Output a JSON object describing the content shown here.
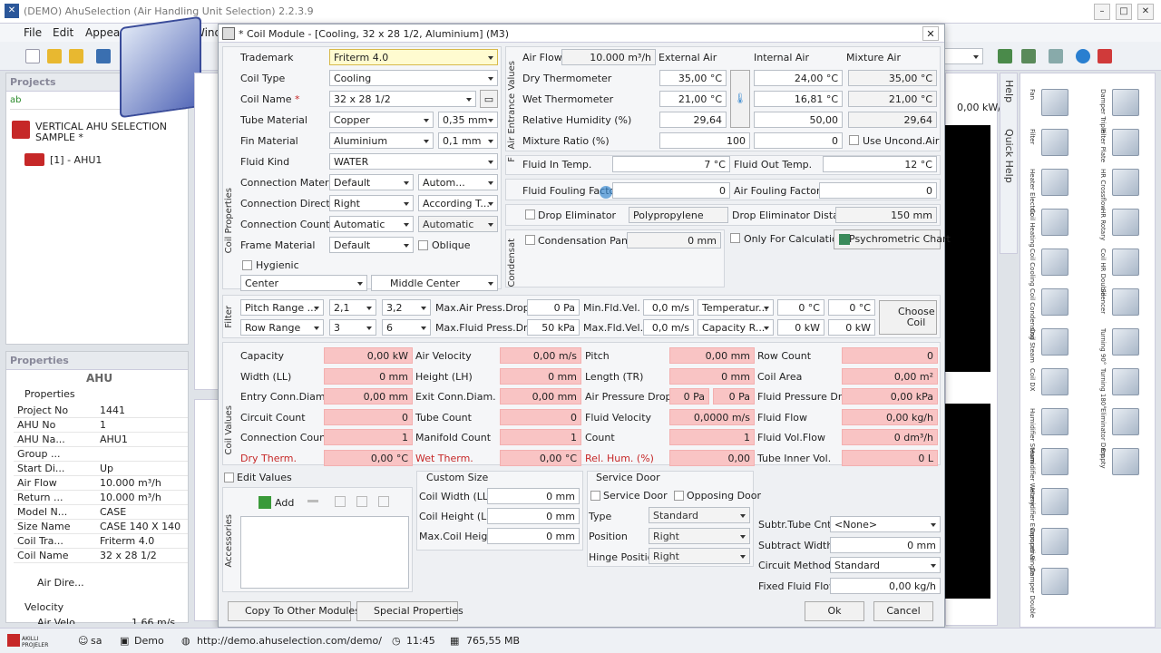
{
  "app": {
    "title": "(DEMO) AhuSelection (Air Handling Unit Selection) 2.2.3.9"
  },
  "menu": {
    "file": "File",
    "edit": "Edit",
    "appearance": "Appear...",
    "window": "Wind"
  },
  "projects": {
    "header": "Projects",
    "root": "VERTICAL AHU SELECTION",
    "root2": "SAMPLE *",
    "ahu": "[1] - AHU1"
  },
  "props": {
    "header": "Properties",
    "title": "AHU",
    "group": "Properties",
    "velocity": "Velocity",
    "rows": [
      {
        "k": "Project No",
        "v": "1441"
      },
      {
        "k": "AHU No",
        "v": "1"
      },
      {
        "k": "AHU Na...",
        "v": "AHU1"
      },
      {
        "k": "Group ...",
        "v": ""
      },
      {
        "k": "Start Di...",
        "v": "Up"
      },
      {
        "k": "Air Flow",
        "v": "10.000 m³/h"
      },
      {
        "k": "Return ...",
        "v": "10.000 m³/h"
      },
      {
        "k": "Model N...",
        "v": "CASE"
      },
      {
        "k": "Size Name",
        "v": "CASE 140 X 140"
      },
      {
        "k": "Coil Tra...",
        "v": "Friterm 4.0"
      },
      {
        "k": "Coil Name",
        "v": "32 x 28 1/2"
      }
    ],
    "airdir": "Air Dire...",
    "airvelo": "Air Velo...",
    "airvelo_v": "1,66 m/s"
  },
  "dialog": {
    "title": "* Coil Module - [Cooling, 32 x 28 1/2, Aluminium] (M3)",
    "coil": {
      "trademark_l": "Trademark",
      "trademark": "Friterm 4.0",
      "type_l": "Coil Type",
      "type": "Cooling",
      "name_l": "Coil Name",
      "name": "32 x 28 1/2",
      "tube_l": "Tube Material",
      "tube": "Copper",
      "tube_t": "0,35 mm",
      "fin_l": "Fin Material",
      "fin": "Aluminium",
      "fin_t": "0,1 mm",
      "fluid_l": "Fluid Kind",
      "fluid": "WATER",
      "conn_l": "Connection Material",
      "conn": "Default",
      "conn2": "Autom...",
      "dir_l": "Connection Direction",
      "dir": "Right",
      "dir2": "According T...",
      "cnt_l": "Connection Count",
      "cnt": "Automatic",
      "cnt2": "Automatic",
      "frame_l": "Frame Material",
      "frame": "Default",
      "oblique": "Oblique",
      "hygienic": "Hygienic",
      "pos": "Center",
      "pos2": "Middle Center",
      "section": "Coil Properties"
    },
    "air": {
      "section": "Air Entrance Values",
      "flow_l": "Air Flow",
      "flow": "10.000 m³/h",
      "ext": "External Air",
      "int": "Internal Air",
      "mix": "Mixture Air",
      "dry_l": "Dry Thermometer",
      "wet_l": "Wet Thermometer",
      "rh_l": "Relative Humidity (%)",
      "mr_l": "Mixture Ratio (%)",
      "ext_dry": "35,00 °C",
      "ext_wet": "21,00 °C",
      "ext_rh": "29,64",
      "ext_mr": "100",
      "int_dry": "24,00 °C",
      "int_wet": "16,81 °C",
      "int_rh": "50,00",
      "int_mr": "0",
      "mix_dry": "35,00 °C",
      "mix_wet": "21,00 °C",
      "mix_rh": "29,64",
      "uncond": "Use Uncond.Air"
    },
    "fluid": {
      "in_l": "Fluid In Temp.",
      "in": "7 °C",
      "out_l": "Fluid Out Temp.",
      "out": "12 °C",
      "ff_l": "Fluid Fouling Factor",
      "ff": "0",
      "af_l": "Air Fouling Factor",
      "af": "0"
    },
    "drop": {
      "l": "Drop Eliminator",
      "v": "Polypropylene",
      "dist_l": "Drop Eliminator Distance",
      "dist": "150 mm"
    },
    "cond": {
      "section": "Condensat",
      "pan": "Condensation Pan",
      "pan_v": "0 mm",
      "calc": "Only For Calculation",
      "psy": "Psychrometric Chart"
    },
    "filter": {
      "section": "Filter",
      "pitch": "Pitch Range ...",
      "pitch1": "2,1",
      "pitch2": "3,2",
      "row": "Row Range",
      "row1": "3",
      "row2": "6",
      "maxair_l": "Max.Air Press.Drop",
      "maxair": "0 Pa",
      "maxfl_l": "Max.Fluid Press.Drop",
      "maxfl": "50 kPa",
      "minvel_l": "Min.Fld.Vel.",
      "minvel": "0,0 m/s",
      "maxvel_l": "Max.Fld.Vel.",
      "maxvel": "0,0 m/s",
      "temp": "Temperatur...",
      "temp1": "0 °C",
      "temp2": "0 °C",
      "cap": "Capacity R...",
      "cap1": "0 kW",
      "cap2": "0 kW",
      "choose": "Choose Coil"
    },
    "values": {
      "section": "Coil Values",
      "rows": [
        [
          {
            "l": "Capacity",
            "v": "0,00 kW"
          },
          {
            "l": "Air Velocity",
            "v": "0,00 m/s"
          },
          {
            "l": "Pitch",
            "v": "0,00 mm"
          },
          {
            "l": "Row Count",
            "v": "0"
          }
        ],
        [
          {
            "l": "Width (LL)",
            "v": "0 mm"
          },
          {
            "l": "Height (LH)",
            "v": "0 mm"
          },
          {
            "l": "Length (TR)",
            "v": "0 mm"
          },
          {
            "l": "Coil Area",
            "v": "0,00 m²"
          }
        ],
        [
          {
            "l": "Entry Conn.Diam.",
            "v": "0,00 mm"
          },
          {
            "l": "Exit Conn.Diam.",
            "v": "0,00 mm"
          },
          {
            "l": "Air Pressure Drop",
            "v": "0 Pa"
          },
          {
            "l": "Fluid Pressure Drop",
            "v": "0,00 kPa"
          }
        ],
        [
          {
            "l": "Circuit Count",
            "v": "0"
          },
          {
            "l": "Tube Count",
            "v": "0"
          },
          {
            "l": "Fluid Velocity",
            "v": "0,0000 m/s"
          },
          {
            "l": "Fluid Flow",
            "v": "0,00 kg/h"
          }
        ],
        [
          {
            "l": "Connection Count",
            "v": "1"
          },
          {
            "l": "Manifold Count",
            "v": "1"
          },
          {
            "l": "Count",
            "v": "1"
          },
          {
            "l": "Fluid Vol.Flow",
            "v": "0 dm³/h"
          }
        ],
        [
          {
            "l": "Dry Therm.",
            "v": "0,00 °C"
          },
          {
            "l": "Wet Therm.",
            "v": "0,00 °C"
          },
          {
            "l": "Rel. Hum. (%)",
            "v": "0,00"
          },
          {
            "l": "Tube Inner Vol.",
            "v": "0 L"
          }
        ]
      ],
      "apd2": "0 Pa"
    },
    "edit": "Edit Values",
    "acc": {
      "section": "Accessories",
      "add": "Add"
    },
    "custom": {
      "title": "Custom Size",
      "w_l": "Coil Width (LL)",
      "w": "0 mm",
      "h_l": "Coil Height (LH)",
      "h": "0 mm",
      "mh_l": "Max.Coil Height",
      "mh": "0 mm"
    },
    "door": {
      "title": "Service Door",
      "sd": "Service Door",
      "od": "Opposing Door",
      "type_l": "Type",
      "type": "Standard",
      "pos_l": "Position",
      "pos": "Right",
      "hinge_l": "Hinge Position",
      "hinge": "Right"
    },
    "sub": {
      "cnt_l": "Subtr.Tube Cnt.",
      "cnt": "<None>",
      "w_l": "Subtract Width",
      "w": "0 mm",
      "cm_l": "Circuit Method",
      "cm": "Standard",
      "ff_l": "Fixed Fluid Flow",
      "ff": "0,00 kg/h"
    },
    "copy": "Copy To Other Modules",
    "special": "Special Properties",
    "ok": "Ok",
    "cancel": "Cancel"
  },
  "right": {
    "help": "Help",
    "quick": "Quick Help",
    "kw": "0,00 kW/",
    "cubes": [
      "Fan",
      "Damper Triple",
      "Filter",
      "Filter Plate",
      "Heater Electric",
      "HR Crossflow",
      "Coil Heating",
      "HR Rotary",
      "Coil Cooling",
      "Coil HR Double",
      "Coil Condensing",
      "Silencer",
      "Coil Steam",
      "Turning 90°",
      "Coil DX",
      "Turning 180°",
      "Humidifier Steam",
      "Eliminator Drop",
      "Humidifier Watery",
      "Empty",
      "Humidifier Evaporative",
      "",
      "Damper Single",
      "",
      "Damper Double",
      ""
    ]
  },
  "status": {
    "user": "sa",
    "mode": "Demo",
    "url": "http://demo.ahuselection.com/demo/",
    "time": "11:45",
    "mem": "765,55 MB",
    "logo": "AKILLI PROJELER"
  },
  "colors": {
    "pink": "#f9c4c4",
    "accent": "#2b579a"
  }
}
